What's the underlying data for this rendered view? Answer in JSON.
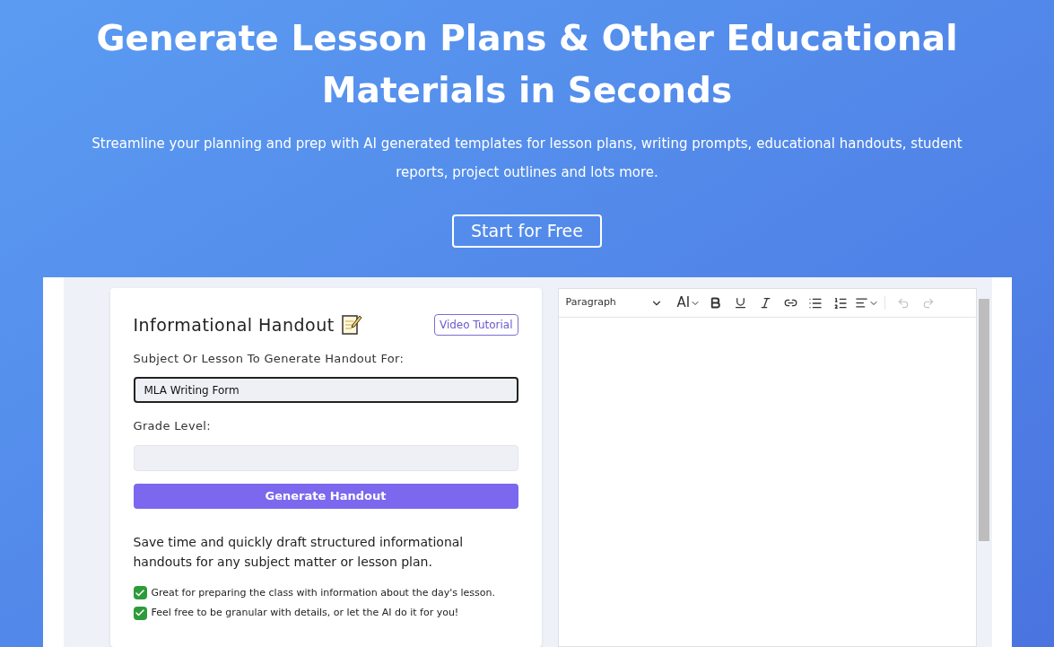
{
  "hero": {
    "title": "Generate Lesson Plans & Other Educational Materials in Seconds",
    "subtitle": "Streamline your planning and prep with AI generated templates for lesson plans, writing prompts, educational handouts, student reports, project outlines and lots more.",
    "cta": "Start for Free"
  },
  "form": {
    "title": "Informational Handout",
    "tutorial_button": "Video Tutorial",
    "fields": [
      {
        "label": "Subject Or Lesson To Generate Handout For:",
        "value": "MLA Writing Form",
        "focused": true
      },
      {
        "label": "Grade Level:",
        "focused": false
      }
    ],
    "submit": "Generate Handout",
    "description": "Save time and quickly draft structured informational handouts for any subject matter or lesson plan.",
    "bullets": [
      {
        "text": "Great for preparing the class with information about the day's lesson.",
        "checked": true
      },
      {
        "text": "Feel free to be granular with details, or let the AI do it for you!",
        "checked": true
      }
    ]
  },
  "editor": {
    "block_format": "Paragraph",
    "font_size_label": "AI",
    "undo_disabled": true,
    "redo_disabled": true
  }
}
